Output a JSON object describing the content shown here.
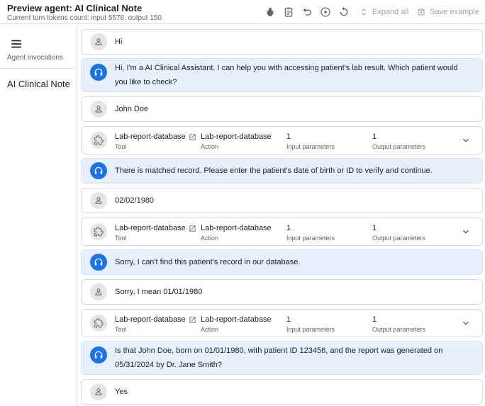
{
  "header": {
    "title": "Preview agent: AI Clinical Note",
    "subtitle": "Current turn tokens count: input 5578, output 150",
    "expand_all": "Expand all",
    "save_example": "Save example"
  },
  "sidebar": {
    "section_label": "Agent invocations",
    "item": "AI Clinical Note"
  },
  "conversation": [
    {
      "role": "user",
      "text": "Hi"
    },
    {
      "role": "agent",
      "text": "Hi, I'm a AI Clinical Assistant. I can help you with accessing patient's lab result. Which patient would you like to check?"
    },
    {
      "role": "user",
      "text": "John Doe"
    },
    {
      "role": "tool",
      "tool": "Lab-report-database",
      "tool_label": "Tool",
      "action": "Lab-report-database",
      "action_label": "Action",
      "input_params": "1",
      "input_label": "Input parameters",
      "output_params": "1",
      "output_label": "Output parameters"
    },
    {
      "role": "agent",
      "text": "There is matched record. Please enter the patient's date of birth or ID to verify and continue."
    },
    {
      "role": "user",
      "text": "02/02/1980"
    },
    {
      "role": "tool",
      "tool": "Lab-report-database",
      "tool_label": "Tool",
      "action": "Lab-report-database",
      "action_label": "Action",
      "input_params": "1",
      "input_label": "Input parameters",
      "output_params": "1",
      "output_label": "Output parameters"
    },
    {
      "role": "agent",
      "text": "Sorry, I can't find this patient's record in our database."
    },
    {
      "role": "user",
      "text": "Sorry, I mean 01/01/1980"
    },
    {
      "role": "tool",
      "tool": "Lab-report-database",
      "tool_label": "Tool",
      "action": "Lab-report-database",
      "action_label": "Action",
      "input_params": "1",
      "input_label": "Input parameters",
      "output_params": "1",
      "output_label": "Output parameters"
    },
    {
      "role": "agent",
      "text": "Is that John Doe, born on 01/01/1980, with patient ID 123456, and the report was generated on 05/31/2024 by Dr. Jane Smith?"
    },
    {
      "role": "user",
      "text": "Yes"
    }
  ],
  "colors": {
    "accent": "#1a73e8",
    "agent_bubble": "#e8f0fe",
    "border": "#dadce0",
    "muted_text": "#5f6368",
    "disabled_text": "#9aa0a6"
  },
  "icons": {
    "toolbar": [
      "bug-icon",
      "clipboard-icon",
      "undo-icon",
      "play-circle-icon",
      "restart-icon",
      "unfold-icon",
      "save-icon"
    ],
    "user_avatar": "person-icon",
    "agent_avatar": "headset-icon",
    "tool_avatar": "extension-icon",
    "open_tool": "open-in-new-icon",
    "expand_row": "chevron-down-icon",
    "menu": "menu-icon"
  }
}
